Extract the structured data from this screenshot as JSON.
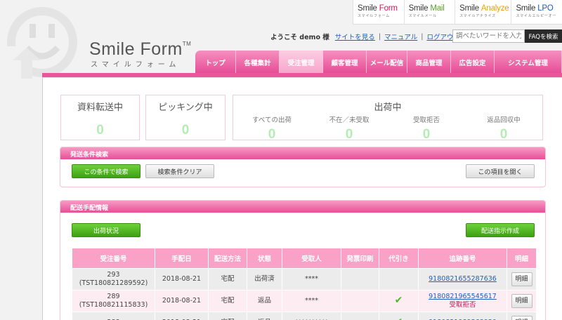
{
  "products": [
    {
      "name_a": "Smile",
      "name_b": "Form",
      "color": "#d4145a",
      "sub": "スマイルフォーム"
    },
    {
      "name_a": "Smile",
      "name_b": "Mail",
      "color": "#5aa02c",
      "sub": "スマイルメール"
    },
    {
      "name_a": "Smile",
      "name_b": "Analyze",
      "color": "#f0a000",
      "sub": "スマイルアナライズ"
    },
    {
      "name_a": "Smile",
      "name_b": "LPO",
      "color": "#1a5fb4",
      "sub": "スマイルエルピーオー"
    }
  ],
  "logo": {
    "title": "Smile Form",
    "tm": "TM",
    "sub": "スマイルフォーム"
  },
  "userbar": {
    "welcome": "ようこそ demo 様",
    "links": [
      "サイトを見る",
      "マニュアル",
      "ログアウト"
    ],
    "sep": "|",
    "search_placeholder": "調べたいワードを入力",
    "faq": "FAQを検索"
  },
  "nav": [
    {
      "label": "トップ",
      "width": 58,
      "active": false
    },
    {
      "label": "各種集計",
      "width": 62,
      "active": false
    },
    {
      "label": "受注管理",
      "width": 62,
      "active": true
    },
    {
      "label": "顧客管理",
      "width": 62,
      "active": false
    },
    {
      "label": "メール配信",
      "width": 58,
      "active": false
    },
    {
      "label": "商品管理",
      "width": 62,
      "active": false
    },
    {
      "label": "広告設定",
      "width": 62,
      "active": false
    },
    {
      "label": "システム管理",
      "width": 96,
      "active": false
    }
  ],
  "stats": {
    "transfer": {
      "label": "資料転送中",
      "value": "0"
    },
    "picking": {
      "label": "ピッキング中",
      "value": "0"
    },
    "shipping": {
      "title": "出荷中",
      "items": [
        {
          "label": "すべての出荷",
          "value": "0"
        },
        {
          "label": "不在／未受取",
          "value": "0"
        },
        {
          "label": "受取拒否",
          "value": "0"
        },
        {
          "label": "返品回収中",
          "value": "0"
        }
      ]
    }
  },
  "search_section": {
    "title": "発送条件検索",
    "search_btn": "この条件で検索",
    "clear_btn": "検索条件クリア",
    "open_btn": "この項目を開く"
  },
  "delivery_section": {
    "title": "配送手配情報",
    "status_btn": "出荷状況",
    "create_btn": "配送指示作成"
  },
  "table": {
    "headers": [
      "受注番号",
      "手配日",
      "配送方法",
      "状態",
      "受取人",
      "発票印刷",
      "代引き",
      "追跡番号",
      "明細"
    ],
    "rows": [
      {
        "order": "293",
        "order_sub": "(TST180821289592)",
        "date": "2018-08-21",
        "method": "宅配",
        "status": "出荷済",
        "recipient": "****",
        "invoice": "",
        "cod": false,
        "tracking": "9180821655287636",
        "tracking_status": "",
        "detail": "明細"
      },
      {
        "order": "289",
        "order_sub": "(TST180821115833)",
        "date": "2018-08-21",
        "method": "宅配",
        "status": "返品",
        "recipient": "****",
        "invoice": "",
        "cod": true,
        "tracking": "9180821965545617",
        "tracking_status": "受取拒否",
        "detail": "明細"
      },
      {
        "order": "288",
        "order_sub": "",
        "date": "2018-08-21",
        "method": "宅配",
        "status": "返品",
        "recipient": "**********",
        "invoice": "",
        "cod": true,
        "tracking": "9180821989368930",
        "tracking_status": "",
        "detail": "明細"
      }
    ]
  }
}
